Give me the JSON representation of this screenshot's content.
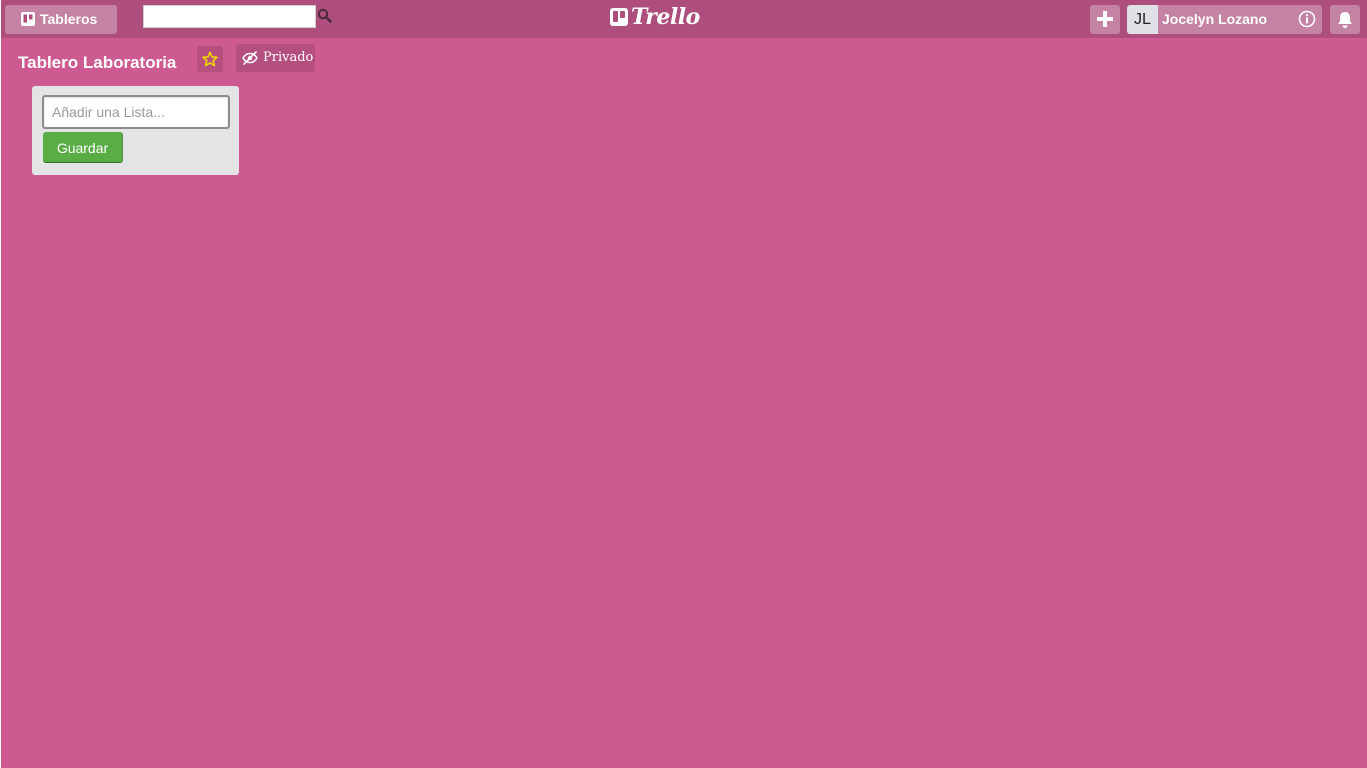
{
  "header": {
    "boards_label": "Tableros",
    "search": {
      "value": "",
      "placeholder": ""
    },
    "logo_text": "Trello",
    "user": {
      "initials": "JL",
      "name": "Jocelyn Lozano"
    },
    "icons": {
      "boards": "boards-icon",
      "search": "search-icon",
      "add": "plus-icon",
      "info": "info-icon",
      "notifications": "bell-icon"
    }
  },
  "board": {
    "title": "Tablero Laboratoria",
    "starred": false,
    "visibility_label": "Privado",
    "icons": {
      "star": "star-icon",
      "visibility": "eye-slash-icon"
    }
  },
  "add_list": {
    "input_value": "",
    "input_placeholder": "Añadir una Lista...",
    "save_label": "Guardar"
  },
  "colors": {
    "background": "#cd5a91",
    "header": "#ad4e7c",
    "composer": "#e2e4e6",
    "save_button": "#5aac44",
    "star": "#f2d600"
  }
}
